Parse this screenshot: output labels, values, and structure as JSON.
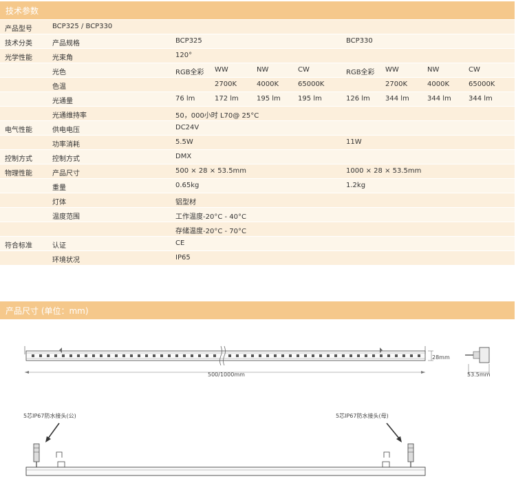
{
  "sections": {
    "specs_title": "技术参数",
    "dims_title": "产品尺寸 (单位：mm)"
  },
  "rows": [
    {
      "cat": "产品型号",
      "prop": "BCP325 / BCP330",
      "v1": "",
      "v2": ""
    },
    {
      "cat": "技术分类",
      "prop": "产品规格",
      "v1": "BCP325",
      "v2": "BCP330"
    },
    {
      "cat": "光学性能",
      "prop": "光束角",
      "v1": "120°",
      "v2": ""
    },
    {
      "cat": "",
      "prop": "光色",
      "a": [
        "RGB全彩",
        "WW",
        "NW",
        "CW"
      ],
      "b": [
        "RGB全彩",
        "WW",
        "NW",
        "CW"
      ]
    },
    {
      "cat": "",
      "prop": "色温",
      "a": [
        "",
        "2700K",
        "4000K",
        "65000K"
      ],
      "b": [
        "",
        "2700K",
        "4000K",
        "65000K"
      ]
    },
    {
      "cat": "",
      "prop": "光通量",
      "a": [
        "76 lm",
        "172 lm",
        "195 lm",
        "195 lm"
      ],
      "b": [
        "126 lm",
        "344 lm",
        "344 lm",
        "344 lm"
      ]
    },
    {
      "cat": "",
      "prop": "光通维持率",
      "v1": "50，000小时 L70@ 25°C",
      "v2": ""
    },
    {
      "cat": "电气性能",
      "prop": "供电电压",
      "v1": "DC24V",
      "v2": ""
    },
    {
      "cat": "",
      "prop": "功率消耗",
      "v1": "5.5W",
      "v2": "11W"
    },
    {
      "cat": "控制方式",
      "prop": "控制方式",
      "v1": "DMX",
      "v2": ""
    },
    {
      "cat": "物理性能",
      "prop": "产品尺寸",
      "v1": "500 × 28 × 53.5mm",
      "v2": "1000 × 28 × 53.5mm"
    },
    {
      "cat": "",
      "prop": "重量",
      "v1": "0.65kg",
      "v2": "1.2kg"
    },
    {
      "cat": "",
      "prop": "灯体",
      "v1": "铝型材",
      "v2": ""
    },
    {
      "cat": "",
      "prop": "温度范围",
      "v1": "工作温度-20°C - 40°C",
      "v2": ""
    },
    {
      "cat": "",
      "prop": "",
      "v1": "存储温度-20°C - 70°C",
      "v2": ""
    },
    {
      "cat": "符合标准",
      "prop": "认证",
      "v1": "CE",
      "v2": ""
    },
    {
      "cat": "",
      "prop": "环境状况",
      "v1": "IP65",
      "v2": ""
    }
  ],
  "drawing": {
    "length_label": "500/1000mm",
    "height_label": "28mm",
    "depth_label": "53.5mm",
    "male_label": "5芯IP67防水接头(公)",
    "female_label": "5芯IP67防水接头(母)"
  }
}
